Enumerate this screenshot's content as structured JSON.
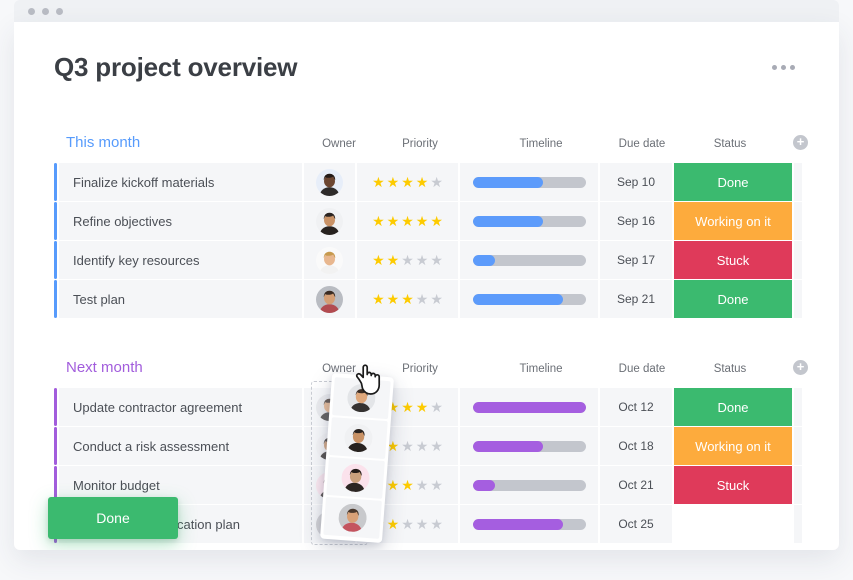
{
  "window": {
    "dots": [
      "close",
      "minimize",
      "maximize"
    ]
  },
  "header": {
    "title": "Q3 project overview",
    "menu_icon": "kebab-menu-icon"
  },
  "columns": {
    "owner": "Owner",
    "priority": "Priority",
    "timeline": "Timeline",
    "due_date": "Due date",
    "status": "Status",
    "add": "+"
  },
  "colors": {
    "this_month_accent": "#579bfc",
    "next_month_accent": "#a25ddc",
    "status_done": "#3bba6f",
    "status_working": "#fdab3d",
    "status_stuck": "#df3a5a",
    "timeline_blue": "#5c9bfb",
    "timeline_purple": "#a55ee0",
    "track": "#c3c6cd",
    "star_on": "#fdcb00",
    "star_off": "#c8cbd2"
  },
  "sections": [
    {
      "id": "this-month",
      "title": "This month",
      "accent": "#579bfc",
      "rows": [
        {
          "name": "Finalize kickoff materials",
          "owner": "avatar-woman-dark-hair",
          "priority": 4,
          "priority_max": 5,
          "progress": 62,
          "due_date": "Sep 10",
          "status": "Done",
          "status_kind": "done"
        },
        {
          "name": "Refine objectives",
          "owner": "avatar-man-beard",
          "priority": 5,
          "priority_max": 5,
          "progress": 62,
          "due_date": "Sep 16",
          "status": "Working on it",
          "status_kind": "working"
        },
        {
          "name": "Identify key resources",
          "owner": "avatar-woman-blonde",
          "priority": 2,
          "priority_max": 5,
          "progress": 20,
          "due_date": "Sep 17",
          "status": "Stuck",
          "status_kind": "stuck"
        },
        {
          "name": "Test plan",
          "owner": "avatar-man-glasses",
          "priority": 3,
          "priority_max": 5,
          "progress": 80,
          "due_date": "Sep 21",
          "status": "Done",
          "status_kind": "done"
        }
      ]
    },
    {
      "id": "next-month",
      "title": "Next month",
      "accent": "#a25ddc",
      "rows": [
        {
          "name": "Update contractor agreement",
          "owner": "avatar-man-short-hair",
          "priority": 4,
          "priority_max": 5,
          "progress": 100,
          "due_date": "Oct 12",
          "status": "Done",
          "status_kind": "done"
        },
        {
          "name": "Conduct a risk assessment",
          "owner": "avatar-man-beard",
          "priority": 2,
          "priority_max": 5,
          "progress": 62,
          "due_date": "Oct 18",
          "status": "Working on it",
          "status_kind": "working"
        },
        {
          "name": "Monitor budget",
          "owner": "avatar-woman-pink",
          "priority": 3,
          "priority_max": 5,
          "progress": 20,
          "due_date": "Oct 21",
          "status": "Stuck",
          "status_kind": "stuck"
        },
        {
          "name": "Develop communication plan",
          "owner": "avatar-man-smiling",
          "priority": 2,
          "priority_max": 5,
          "progress": 80,
          "due_date": "Oct 25",
          "status": "Done",
          "status_kind": "done",
          "dragging": true
        }
      ]
    }
  ],
  "drag": {
    "cursor_icon": "hand-drag-cursor",
    "dropzone_label": "owner-column-dropzone",
    "card_avatars": [
      "avatar-man-short-hair",
      "avatar-man-beard",
      "avatar-woman-pink",
      "avatar-man-smiling"
    ]
  }
}
